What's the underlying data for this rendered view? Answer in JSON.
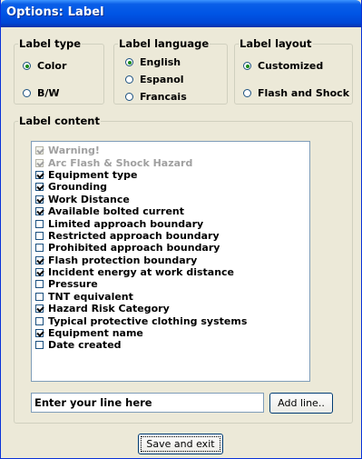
{
  "window": {
    "title": "Options: Label"
  },
  "label_type": {
    "legend": "Label type",
    "options": [
      {
        "label": "Color",
        "selected": true
      },
      {
        "label": "B/W",
        "selected": false
      }
    ]
  },
  "label_language": {
    "legend": "Label language",
    "options": [
      {
        "label": "English",
        "selected": true
      },
      {
        "label": "Espanol",
        "selected": false
      },
      {
        "label": "Francais",
        "selected": false
      }
    ]
  },
  "label_layout": {
    "legend": "Label layout",
    "options": [
      {
        "label": "Customized",
        "selected": true
      },
      {
        "label": "Flash and Shock",
        "selected": false
      }
    ]
  },
  "label_content": {
    "legend": "Label content",
    "items": [
      {
        "label": "Warning!",
        "checked": true,
        "disabled": true
      },
      {
        "label": "Arc Flash & Shock Hazard",
        "checked": true,
        "disabled": true
      },
      {
        "label": "Equipment type",
        "checked": true,
        "disabled": false
      },
      {
        "label": "Grounding",
        "checked": true,
        "disabled": false
      },
      {
        "label": "Work Distance",
        "checked": true,
        "disabled": false
      },
      {
        "label": "Available bolted current",
        "checked": true,
        "disabled": false
      },
      {
        "label": "Limited approach boundary",
        "checked": false,
        "disabled": false
      },
      {
        "label": "Restricted approach boundary",
        "checked": false,
        "disabled": false
      },
      {
        "label": "Prohibited approach boundary",
        "checked": false,
        "disabled": false
      },
      {
        "label": "Flash protection boundary",
        "checked": true,
        "disabled": false
      },
      {
        "label": "Incident energy at work distance",
        "checked": true,
        "disabled": false
      },
      {
        "label": "Pressure",
        "checked": false,
        "disabled": false
      },
      {
        "label": "TNT equivalent",
        "checked": false,
        "disabled": false
      },
      {
        "label": "Hazard Risk Category",
        "checked": true,
        "disabled": false
      },
      {
        "label": "Typical protective clothing systems",
        "checked": false,
        "disabled": false
      },
      {
        "label": "Equipment name",
        "checked": true,
        "disabled": false
      },
      {
        "label": "Date created",
        "checked": false,
        "disabled": false
      }
    ],
    "line_input_value": "Enter your line here",
    "add_line_label": "Add line.."
  },
  "save_exit_label": "Save and exit"
}
